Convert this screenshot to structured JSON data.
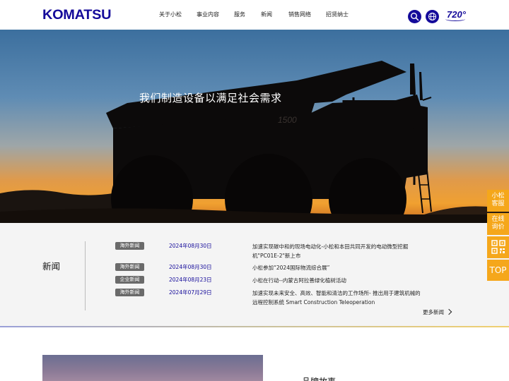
{
  "header": {
    "logo": "KOMATSU",
    "nav": [
      "关于小松",
      "事业内容",
      "服务",
      "新闻",
      "销售网络",
      "招贤纳士"
    ],
    "badge": "720°"
  },
  "hero": {
    "slogan": "我们制造设备以满足社会需求",
    "truck_number": "1500"
  },
  "news": {
    "heading": "新闻",
    "items": [
      {
        "tag": "海外新闻",
        "date": "2024年08月30日",
        "title": "加速实现碳中和的现场电动化-小松和本田共同开发的电动微型挖掘机\"PC01E-2\"新上市"
      },
      {
        "tag": "海外新闻",
        "date": "2024年08月30日",
        "title": "小松参加“2024国际物流综合展”"
      },
      {
        "tag": "企业新闻",
        "date": "2024年08月23日",
        "title": "小松在行动--内蒙古阿拉善绿化植树活动"
      },
      {
        "tag": "海外新闻",
        "date": "2024年07月29日",
        "title": "加速实现未来安全、高效、智能和清洁的工作场所- 推出用于建筑机械的远程控制系统 Smart Construction Teleoperation"
      }
    ],
    "more": "更多新闻"
  },
  "brand": {
    "title": "品牌故事"
  },
  "side": {
    "service": "小松客服",
    "consult": "在线询价",
    "top": "TOP"
  },
  "colors": {
    "brand_blue": "#140a9a",
    "accent_orange": "#f5a71b"
  }
}
